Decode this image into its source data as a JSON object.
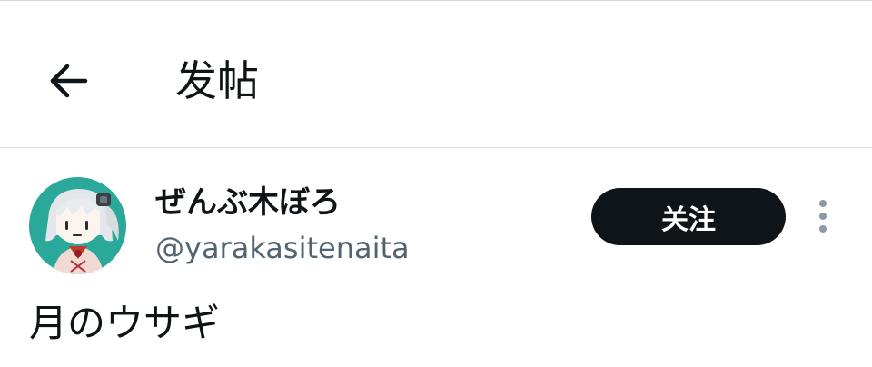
{
  "header": {
    "title": "发帖",
    "back_icon": "arrow-left-icon"
  },
  "author": {
    "display_name": "ぜんぶ木ぼろ",
    "handle": "@yarakasitenaita",
    "avatar_icon": "avatar-illustration",
    "avatar_bg_color": "#2aa89a"
  },
  "actions": {
    "follow_label": "关注",
    "follow_bg_color": "#0f1419",
    "more_icon": "more-vertical-icon"
  },
  "post": {
    "text": "月のウサギ"
  },
  "colors": {
    "text_primary": "#0f1419",
    "text_secondary": "#536471",
    "divider": "#dde3e7"
  }
}
